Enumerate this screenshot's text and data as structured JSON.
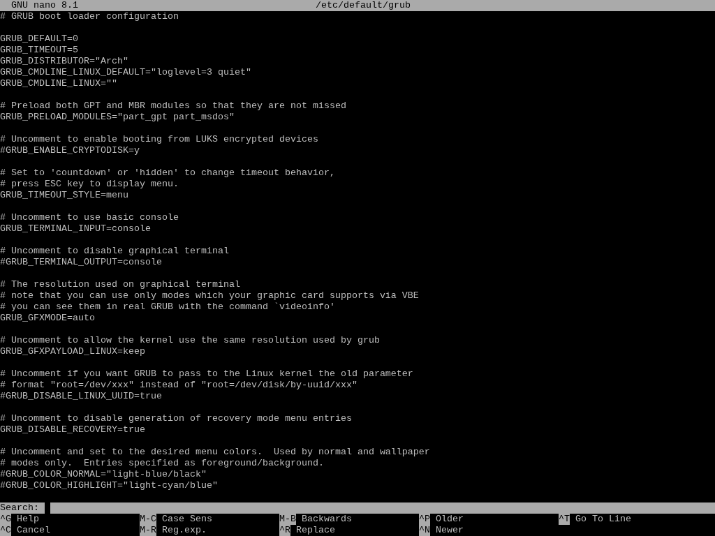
{
  "title_bar": {
    "app": "GNU nano 8.1",
    "file": "/etc/default/grub"
  },
  "blocks": [
    [
      "# GRUB boot loader configuration"
    ],
    [
      "GRUB_DEFAULT=0",
      "GRUB_TIMEOUT=5",
      "GRUB_DISTRIBUTOR=\"Arch\"",
      "GRUB_CMDLINE_LINUX_DEFAULT=\"loglevel=3 quiet\"",
      "GRUB_CMDLINE_LINUX=\"\""
    ],
    [
      "# Preload both GPT and MBR modules so that they are not missed",
      "GRUB_PRELOAD_MODULES=\"part_gpt part_msdos\""
    ],
    [
      "# Uncomment to enable booting from LUKS encrypted devices",
      "#GRUB_ENABLE_CRYPTODISK=y"
    ],
    [
      "# Set to 'countdown' or 'hidden' to change timeout behavior,",
      "# press ESC key to display menu.",
      "GRUB_TIMEOUT_STYLE=menu"
    ],
    [
      "# Uncomment to use basic console",
      "GRUB_TERMINAL_INPUT=console"
    ],
    [
      "# Uncomment to disable graphical terminal",
      "#GRUB_TERMINAL_OUTPUT=console"
    ],
    [
      "# The resolution used on graphical terminal",
      "# note that you can use only modes which your graphic card supports via VBE",
      "# you can see them in real GRUB with the command `videoinfo'",
      "GRUB_GFXMODE=auto"
    ],
    [
      "# Uncomment to allow the kernel use the same resolution used by grub",
      "GRUB_GFXPAYLOAD_LINUX=keep"
    ],
    [
      "# Uncomment if you want GRUB to pass to the Linux kernel the old parameter",
      "# format \"root=/dev/xxx\" instead of \"root=/dev/disk/by-uuid/xxx\"",
      "#GRUB_DISABLE_LINUX_UUID=true"
    ],
    [
      "# Uncomment to disable generation of recovery mode menu entries",
      "GRUB_DISABLE_RECOVERY=true"
    ],
    [
      "# Uncomment and set to the desired menu colors.  Used by normal and wallpaper",
      "# modes only.  Entries specified as foreground/background.",
      "#GRUB_COLOR_NORMAL=\"light-blue/black\"",
      "#GRUB_COLOR_HIGHLIGHT=\"light-cyan/blue\""
    ]
  ],
  "prompt": {
    "label": "Search:"
  },
  "shortcuts": [
    [
      {
        "key": "^G",
        "label": "Help"
      },
      {
        "key": "M-C",
        "label": "Case Sens"
      },
      {
        "key": "M-B",
        "label": "Backwards"
      },
      {
        "key": "^P",
        "label": "Older"
      },
      {
        "key": "^T",
        "label": "Go To Line"
      }
    ],
    [
      {
        "key": "^C",
        "label": "Cancel"
      },
      {
        "key": "M-R",
        "label": "Reg.exp."
      },
      {
        "key": "^R",
        "label": "Replace"
      },
      {
        "key": "^N",
        "label": "Newer"
      }
    ]
  ]
}
